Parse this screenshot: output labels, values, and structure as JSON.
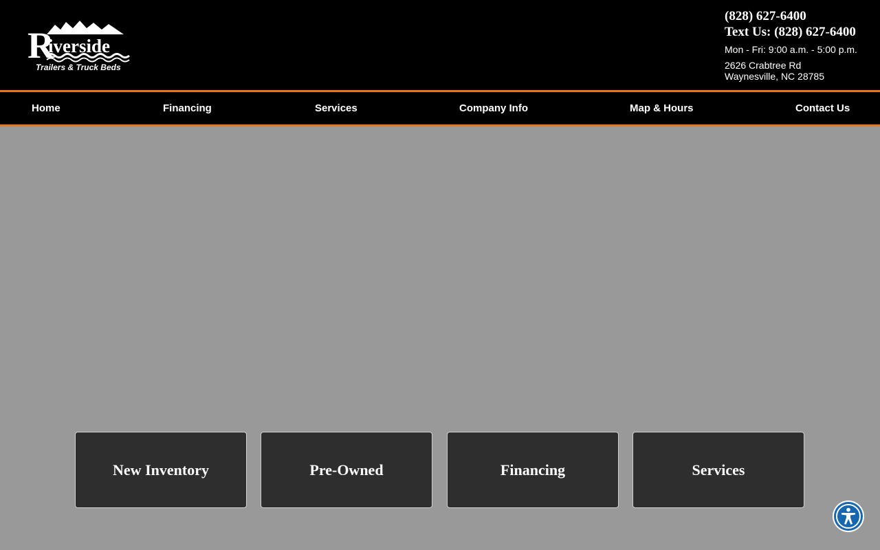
{
  "brand": {
    "name": "Riverside",
    "tagline": "Trailers & Truck Beds"
  },
  "contact": {
    "phone": "(828) 627-6400",
    "text_us": "Text Us: (828) 627-6400",
    "hours": "Mon - Fri: 9:00 a.m. - 5:00 p.m.",
    "address_line1": "2626 Crabtree Rd",
    "address_line2": "Waynesville, NC 28785"
  },
  "nav": {
    "items": [
      {
        "label": "Home"
      },
      {
        "label": "Financing"
      },
      {
        "label": "Services"
      },
      {
        "label": "Company Info"
      },
      {
        "label": "Map & Hours"
      },
      {
        "label": "Contact Us"
      }
    ]
  },
  "tiles": [
    {
      "label": "New Inventory"
    },
    {
      "label": "Pre-Owned"
    },
    {
      "label": "Financing"
    },
    {
      "label": "Services"
    }
  ],
  "accessibility": {
    "icon": "accessibility-icon"
  },
  "colors": {
    "header_bg": "#000000",
    "accent": "#e8761c",
    "page_bg": "#999999",
    "tile_bg": "#2e2e2e",
    "a11y_blue": "#1766b0"
  }
}
